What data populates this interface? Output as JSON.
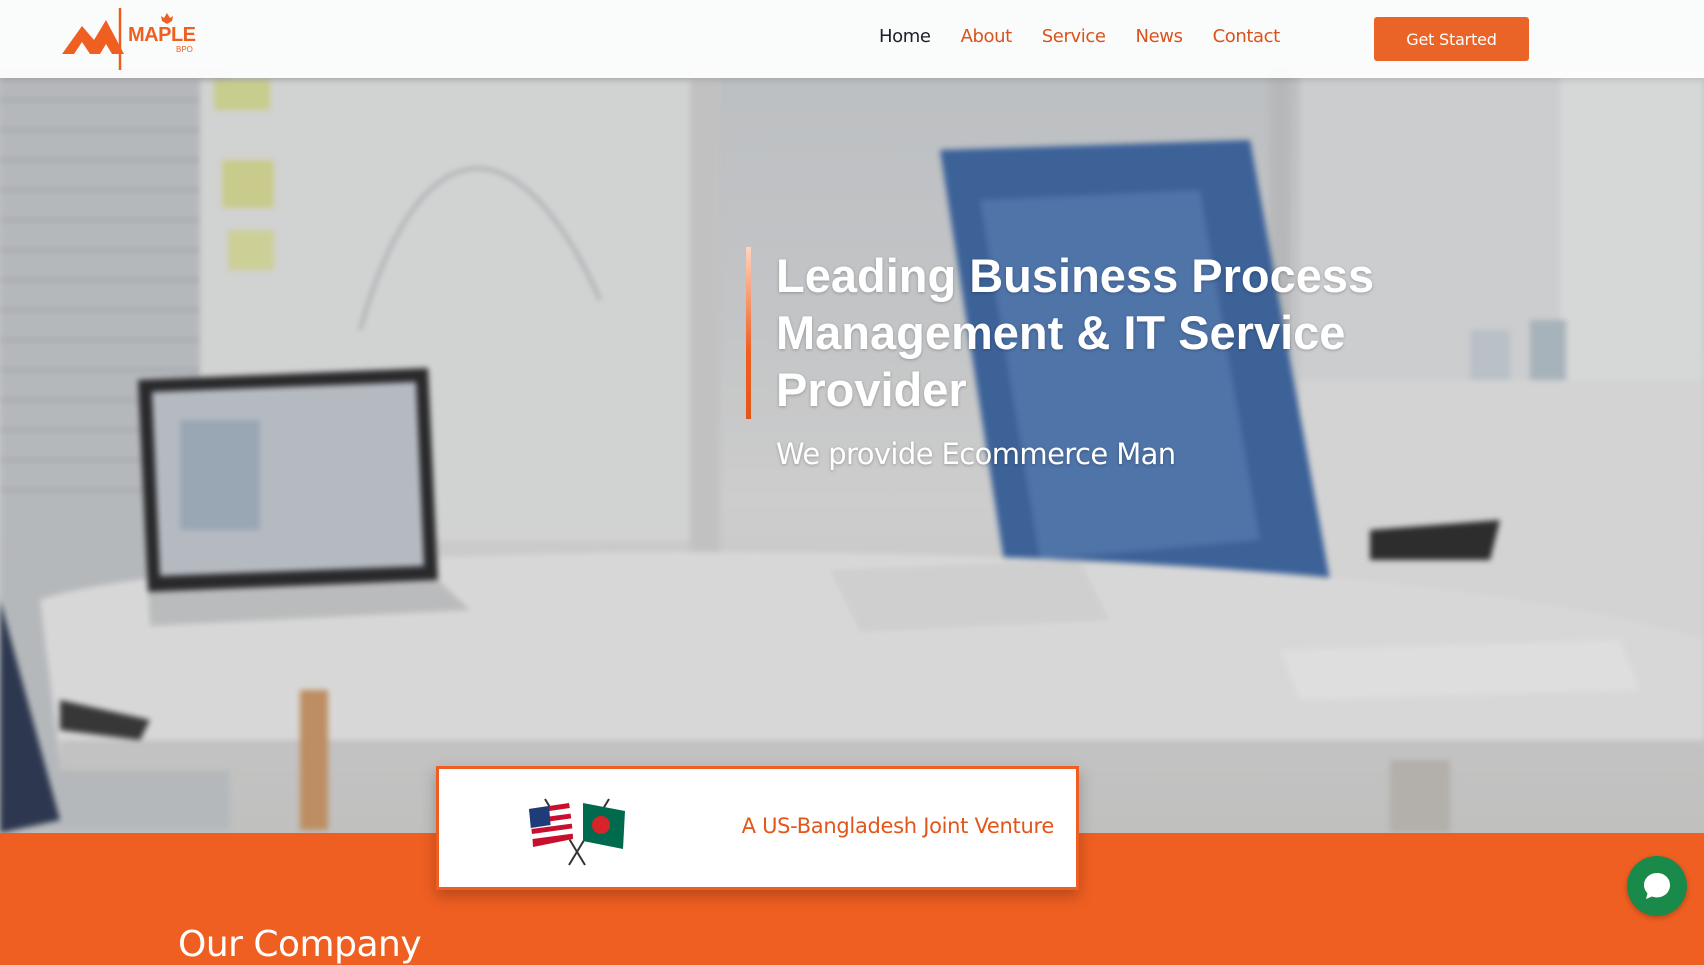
{
  "brand": {
    "name": "MAPLE",
    "sub": "BPO",
    "primary_color": "#f05f22",
    "nav_active_color": "#1d1d2b"
  },
  "nav": {
    "items": [
      {
        "label": "Home",
        "active": true
      },
      {
        "label": "About",
        "active": false
      },
      {
        "label": "Service",
        "active": false
      },
      {
        "label": "News",
        "active": false
      },
      {
        "label": "Contact",
        "active": false
      }
    ],
    "cta_label": "Get Started"
  },
  "hero": {
    "title": "Leading Business Process Management & IT Service Provider",
    "subtitle": "We provide Ecommerce Man"
  },
  "venture": {
    "text": "A US-Bangladesh Joint Venture",
    "flag_icons": [
      "us-flag-icon",
      "bangladesh-flag-icon"
    ]
  },
  "section": {
    "heading": "Our Company"
  },
  "chat": {
    "icon": "chat-bubble-icon",
    "color": "#1a8a4a"
  }
}
